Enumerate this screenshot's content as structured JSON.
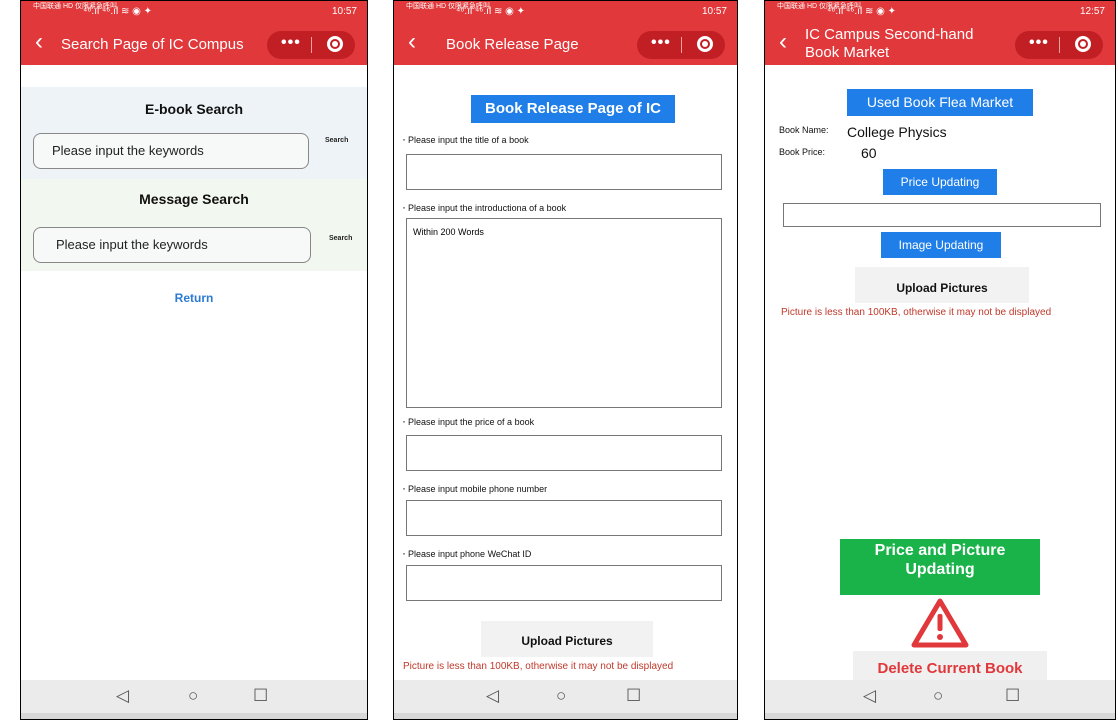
{
  "statusbar": {
    "carrier": "中国联通 HD 仅限紧急呼叫",
    "signal": "⁴⁶.ıl ⁴⁶.ıl ≋ ◉ ✦",
    "time_a": "10:57",
    "time_b": "10:57",
    "time_c": "12:57"
  },
  "panel_search": {
    "title": "Search Page of IC Compus",
    "ebook_heading": "E-book Search",
    "ebook_placeholder": "Please input the keywords",
    "ebook_search_label": "Search",
    "message_heading": "Message Search",
    "message_placeholder": "Please input the keywords",
    "message_search_label": "Search",
    "return_label": "Return"
  },
  "panel_release": {
    "title": "Book Release Page",
    "header_button": "Book Release Page of IC",
    "label_title": "Please input the title of a book",
    "label_intro": "Please input the introductiona of a book",
    "intro_placeholder": "Within 200 Words",
    "label_price": "Please input the price of a book",
    "label_mobile": "Please input mobile phone number",
    "label_wechat": "Please input phone WeChat ID",
    "upload_label": "Upload Pictures",
    "upload_note": "Picture is less than 100KB, otherwise it may not be displayed"
  },
  "panel_market": {
    "title_line1": "IC Campus Second-hand",
    "title_line2": "Book Market",
    "header_button": "Used Book Flea Market",
    "book_name_label": "Book Name:",
    "book_name_value": "College Physics",
    "book_price_label": "Book Price:",
    "book_price_value": "60",
    "price_updating_label": "Price Updating",
    "image_updating_label": "Image Updating",
    "upload_label": "Upload Pictures",
    "upload_note": "Picture is less than 100KB, otherwise it may not be displayed",
    "annotation_line1": "Price and Picture",
    "annotation_line2": "Updating",
    "delete_label": "Delete Current Book"
  },
  "capsule": {
    "more": "•••"
  },
  "navbar": {
    "back": "◁",
    "home": "○",
    "recent": "☐"
  },
  "colors": {
    "brand_red": "#e0383b",
    "button_blue": "#1f7ee8",
    "link_blue": "#2d7ad6",
    "green": "#19b34a"
  }
}
